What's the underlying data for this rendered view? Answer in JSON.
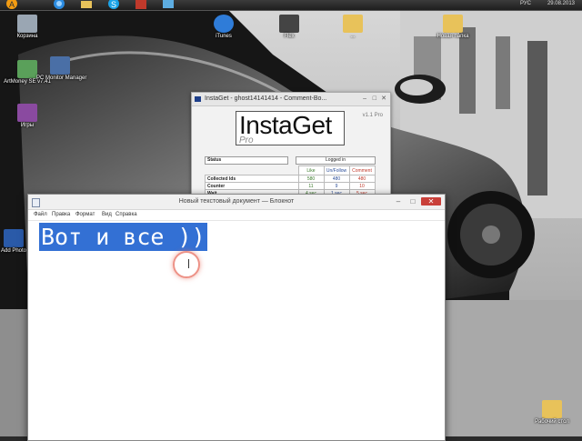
{
  "taskbar": {
    "buttons": [
      "avast-icon",
      "ie-icon",
      "explorer-icon",
      "skype-icon",
      "app-icon",
      "files-icon"
    ],
    "lang": "РУС",
    "clock": "29.08.2013"
  },
  "desktop_icons": [
    {
      "id": "recycle-bin",
      "label": "Корзина",
      "color": "#9aa6b3"
    },
    {
      "id": "artmoney",
      "label": "ArtMoney SE v7.41",
      "color": "#5aa05a"
    },
    {
      "id": "pc-monitor",
      "label": "PC Monitor Manager",
      "color": "#4a6fa6"
    },
    {
      "id": "games",
      "label": "Игры",
      "color": "#8a4aa0"
    },
    {
      "id": "itunes",
      "label": "iTunes",
      "color": "#2f7cd8"
    },
    {
      "id": "flex",
      "label": "Flex",
      "color": "#444444"
    },
    {
      "id": "folder-1",
      "label": "...",
      "color": "#e8c25a"
    },
    {
      "id": "new-folder",
      "label": "Новая папка",
      "color": "#e8c25a"
    },
    {
      "id": "adobe",
      "label": "Add Photo",
      "color": "#2a5aa8"
    },
    {
      "id": "work-folder",
      "label": "Рабочий стол",
      "color": "#e8c25a"
    }
  ],
  "instaget": {
    "title": "InstaGet - ghost14141414 - Comment-Bo...",
    "logo_main": "InstaGet",
    "logo_sub": "Pro",
    "version": "v1.1 Pro",
    "status_label": "Status",
    "logged_text": "Logged in",
    "columns": [
      "Like",
      "Un/Follow",
      "Comment"
    ],
    "rows": [
      {
        "name": "Collected Ids",
        "values": [
          "580",
          "480",
          "480"
        ]
      },
      {
        "name": "Counter",
        "values": [
          "11",
          "9",
          "10"
        ]
      },
      {
        "name": "Wait",
        "values": [
          "4 sec",
          "1 sec",
          "5 sec"
        ]
      }
    ]
  },
  "notepad": {
    "title": "Новый текстовый документ — Блокнот",
    "menu": [
      "Файл",
      "Правка",
      "Формат",
      "Вид",
      "Справка"
    ],
    "content": "Вот и все ))"
  }
}
